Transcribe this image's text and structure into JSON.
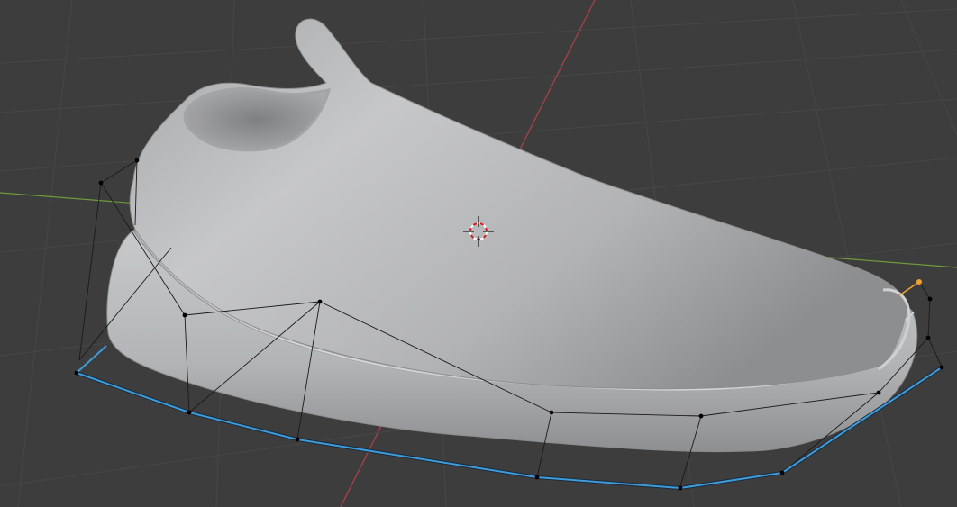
{
  "viewport": {
    "editor": "3D Viewport",
    "shading": "solid",
    "colors": {
      "background": "#3d3d3d",
      "grid_line": "#4a4a4a",
      "axis_x": "#b0404e",
      "axis_y": "#6f9a3a",
      "selected_edge": "#3e9bd9",
      "active_vertex": "#f0a030",
      "vertex": "#000000",
      "mesh_base": "#8f9092",
      "mesh_highlight": "#c9cacc"
    }
  },
  "objects": [
    {
      "name_icon": "shoe-mesh",
      "type": "mesh"
    },
    {
      "name_icon": "cage-lattice",
      "type": "cage",
      "mode": "edit"
    }
  ],
  "cursor": {
    "icon": "3d-cursor-icon"
  }
}
